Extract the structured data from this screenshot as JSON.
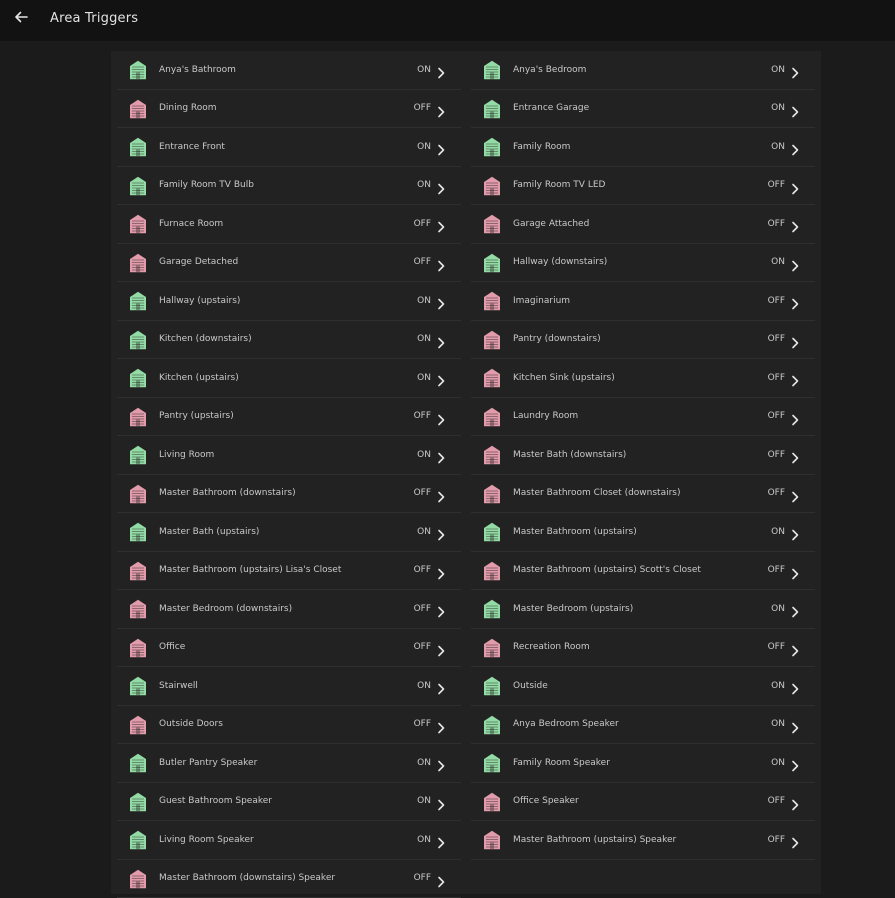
{
  "header": {
    "title": "Area Triggers",
    "back_icon": "arrow-left-icon"
  },
  "colors": {
    "on": "#9ef0b4",
    "off": "#f6a9b9"
  },
  "left_items": [
    {
      "label": "Anya's Bathroom",
      "state": "ON"
    },
    {
      "label": "Dining Room",
      "state": "OFF"
    },
    {
      "label": "Entrance Front",
      "state": "ON"
    },
    {
      "label": "Family Room TV Bulb",
      "state": "ON"
    },
    {
      "label": "Furnace Room",
      "state": "OFF"
    },
    {
      "label": "Garage Detached",
      "state": "OFF"
    },
    {
      "label": "Hallway (upstairs)",
      "state": "ON"
    },
    {
      "label": "Kitchen (downstairs)",
      "state": "ON"
    },
    {
      "label": "Kitchen (upstairs)",
      "state": "ON"
    },
    {
      "label": "Pantry (upstairs)",
      "state": "OFF"
    },
    {
      "label": "Living Room",
      "state": "ON"
    },
    {
      "label": "Master Bathroom (downstairs)",
      "state": "OFF"
    },
    {
      "label": "Master Bath (upstairs)",
      "state": "ON"
    },
    {
      "label": "Master Bathroom (upstairs) Lisa's Closet",
      "state": "OFF"
    },
    {
      "label": "Master Bedroom (downstairs)",
      "state": "OFF"
    },
    {
      "label": "Office",
      "state": "OFF"
    },
    {
      "label": "Stairwell",
      "state": "ON"
    },
    {
      "label": "Outside Doors",
      "state": "OFF"
    },
    {
      "label": "Butler Pantry Speaker",
      "state": "ON"
    },
    {
      "label": "Guest Bathroom Speaker",
      "state": "ON"
    },
    {
      "label": "Living Room Speaker",
      "state": "ON"
    },
    {
      "label": "Master Bathroom (downstairs) Speaker",
      "state": "OFF"
    }
  ],
  "right_items": [
    {
      "label": "Anya's Bedroom",
      "state": "ON"
    },
    {
      "label": "Entrance Garage",
      "state": "ON"
    },
    {
      "label": "Family Room",
      "state": "ON"
    },
    {
      "label": "Family Room TV LED",
      "state": "OFF"
    },
    {
      "label": "Garage Attached",
      "state": "OFF"
    },
    {
      "label": "Hallway (downstairs)",
      "state": "ON"
    },
    {
      "label": "Imaginarium",
      "state": "OFF"
    },
    {
      "label": "Pantry (downstairs)",
      "state": "OFF"
    },
    {
      "label": "Kitchen Sink (upstairs)",
      "state": "OFF"
    },
    {
      "label": "Laundry Room",
      "state": "OFF"
    },
    {
      "label": "Master Bath (downstairs)",
      "state": "OFF"
    },
    {
      "label": "Master Bathroom Closet (downstairs)",
      "state": "OFF"
    },
    {
      "label": "Master Bathroom (upstairs)",
      "state": "ON"
    },
    {
      "label": "Master Bathroom (upstairs) Scott's Closet",
      "state": "OFF"
    },
    {
      "label": "Master Bedroom (upstairs)",
      "state": "ON"
    },
    {
      "label": "Recreation Room",
      "state": "OFF"
    },
    {
      "label": "Outside",
      "state": "ON"
    },
    {
      "label": "Anya Bedroom Speaker",
      "state": "ON"
    },
    {
      "label": "Family Room Speaker",
      "state": "ON"
    },
    {
      "label": "Office Speaker",
      "state": "OFF"
    },
    {
      "label": "Master Bathroom (upstairs) Speaker",
      "state": "OFF"
    }
  ]
}
